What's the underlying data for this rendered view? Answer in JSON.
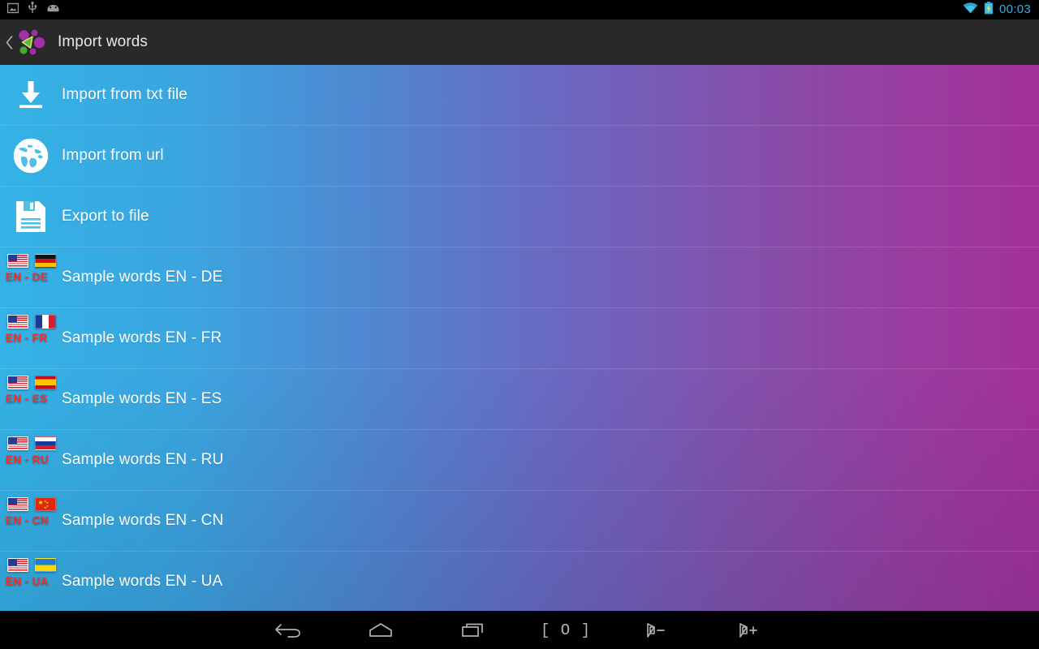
{
  "status_bar": {
    "icons": [
      "screenshot-icon",
      "usb-icon",
      "android-icon"
    ],
    "wifi_icon": "wifi-icon",
    "battery_icon": "battery-charging-icon",
    "time": "00:03"
  },
  "action_bar": {
    "up_icon": "back-chevron-icon",
    "logo_icon": "app-logo-icon",
    "title": "Import words"
  },
  "colors": {
    "gradient_start": "#33b3e6",
    "gradient_end": "#a33199",
    "action_bar_bg": "#292929",
    "status_bar_bg": "#000000",
    "accent_clock": "#3badda",
    "flag_code_text": "#ff2b2b",
    "list_text": "#ffffff"
  },
  "list": {
    "actions": [
      {
        "label": "Import from txt file",
        "icon": "download-icon"
      },
      {
        "label": "Import from url",
        "icon": "globe-icon"
      },
      {
        "label": "Export to file",
        "icon": "floppy-disk-save-icon"
      }
    ],
    "samples": [
      {
        "label": "Sample words EN - DE",
        "code": "EN - DE",
        "from_flag": "flag-us",
        "to_flag": "flag-de"
      },
      {
        "label": "Sample words EN - FR",
        "code": "EN - FR",
        "from_flag": "flag-us",
        "to_flag": "flag-fr"
      },
      {
        "label": "Sample words EN - ES",
        "code": "EN - ES",
        "from_flag": "flag-us",
        "to_flag": "flag-es"
      },
      {
        "label": "Sample words EN - RU",
        "code": "EN - RU",
        "from_flag": "flag-us",
        "to_flag": "flag-ru"
      },
      {
        "label": "Sample words EN - CN",
        "code": "EN - CN",
        "from_flag": "flag-us",
        "to_flag": "flag-cn"
      },
      {
        "label": "Sample words EN - UA",
        "code": "EN - UA",
        "from_flag": "flag-us",
        "to_flag": "flag-ua"
      }
    ]
  },
  "nav_bar": {
    "buttons": [
      {
        "name": "back-button",
        "icon": "back-arrow-icon",
        "label": ""
      },
      {
        "name": "home-button",
        "icon": "home-icon",
        "label": ""
      },
      {
        "name": "recents-button",
        "icon": "recent-apps-icon",
        "label": ""
      },
      {
        "name": "screenshot-button",
        "icon": "screenshot-icon",
        "label": "[ O ]"
      },
      {
        "name": "volume-down-button",
        "icon": "volume-down-icon",
        "label": ""
      },
      {
        "name": "volume-up-button",
        "icon": "volume-up-icon",
        "label": ""
      }
    ]
  }
}
